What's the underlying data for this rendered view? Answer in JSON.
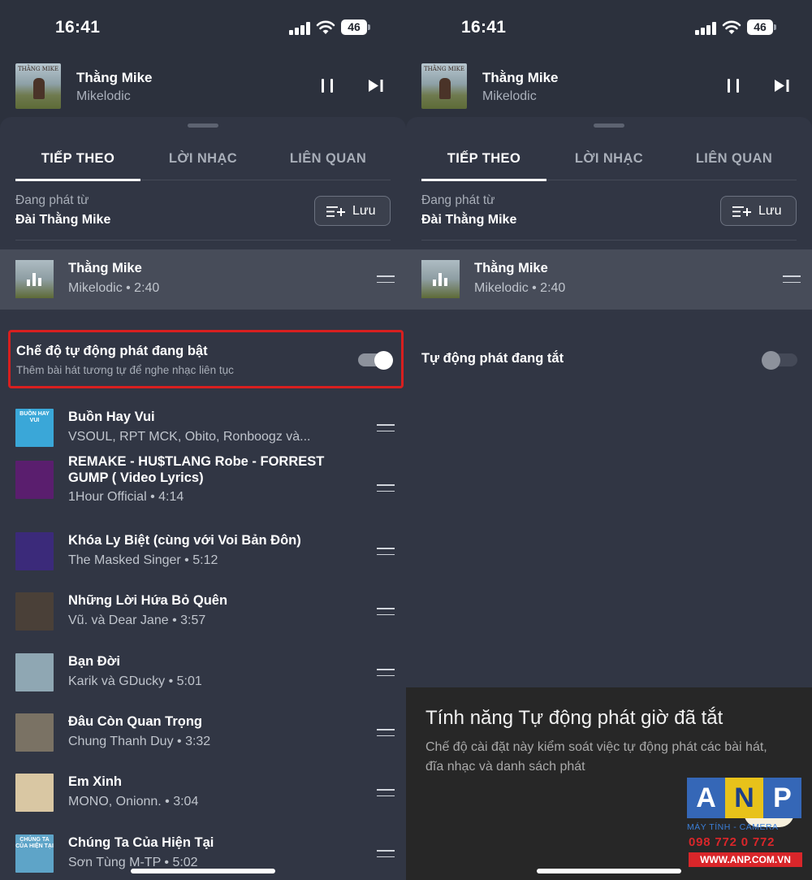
{
  "status": {
    "time": "16:41",
    "battery": "46"
  },
  "now_playing": {
    "title": "Thằng Mike",
    "artist": "Mikelodic",
    "art_text": "THẰNG MIKE"
  },
  "tabs": [
    {
      "label": "TIẾP THEO"
    },
    {
      "label": "LỜI NHẠC"
    },
    {
      "label": "LIÊN QUAN"
    }
  ],
  "playing_from": {
    "label": "Đang phát từ",
    "value": "Đài Thằng Mike",
    "save_label": "Lưu"
  },
  "current": {
    "title": "Thằng Mike",
    "subtitle": "Mikelodic • 2:40"
  },
  "autoplay_on": {
    "title": "Chế độ tự động phát đang bật",
    "description": "Thêm bài hát tương tự để nghe nhạc liên tục",
    "enabled": true
  },
  "queue": [
    {
      "title": "Buồn Hay Vui",
      "subtitle": "VSOUL, RPT MCK, Obito, Ronboogz và...",
      "art_color": "#3aa7d8",
      "art_text": "BUỒN HAY VUI"
    },
    {
      "title": "REMAKE - HU$TLANG Robe - FORREST GUMP ( Video Lyrics)",
      "subtitle": "1Hour Official • 4:14",
      "art_color": "#5a1e6e",
      "art_text": ""
    },
    {
      "title": "Khóa Ly Biệt (cùng với Voi Bản Đôn)",
      "subtitle": "The Masked Singer • 5:12",
      "art_color": "#3b2a7a",
      "art_text": ""
    },
    {
      "title": "Những Lời Hứa Bỏ Quên",
      "subtitle": "Vũ. và Dear Jane • 3:57",
      "art_color": "#4a4038",
      "art_text": ""
    },
    {
      "title": "Bạn Đời",
      "subtitle": "Karik và GDucky • 5:01",
      "art_color": "#8fa7b3",
      "art_text": ""
    },
    {
      "title": "Đâu Còn Quan Trọng",
      "subtitle": "Chung Thanh Duy • 3:32",
      "art_color": "#7a7264",
      "art_text": ""
    },
    {
      "title": "Em Xinh",
      "subtitle": "MONO, Onionn. • 3:04",
      "art_color": "#d9c7a3",
      "art_text": ""
    },
    {
      "title": "Chúng Ta Của Hiện Tại",
      "subtitle": "Sơn Tùng M-TP • 5:02",
      "art_color": "#5ea4c8",
      "art_text": "CHÚNG TA CỦA HIỆN TẠI"
    }
  ],
  "autoplay_off": {
    "title": "Tự động phát đang tắt",
    "enabled": false
  },
  "toast": {
    "title": "Tính năng Tự động phát giờ đã tắt",
    "body": "Chế độ cài đặt này kiểm soát việc tự động phát các bài hát, đĩa nhạc và danh sách phát",
    "ok_label": "OK"
  },
  "watermark": {
    "a": "A",
    "n": "N",
    "p": "P",
    "tagline": "MÁY TÍNH - CAMERA",
    "phone": "098 772 0 772",
    "site": "WWW.ANP.COM.VN"
  },
  "colors": {
    "background": "#2c313d",
    "sheet": "#313644",
    "current_row": "#474c59",
    "highlight_border": "#d81f1f",
    "toast": "#272727"
  }
}
